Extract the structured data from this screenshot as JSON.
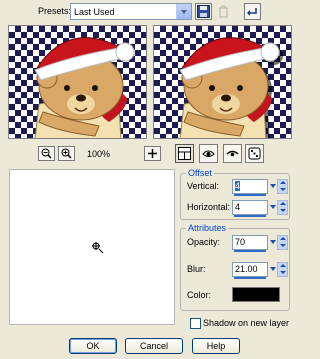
{
  "presets": {
    "label": "Presets:",
    "selected": "Last Used",
    "save_icon": "floppy-disk-icon",
    "delete_icon": "trash-icon",
    "reset_icon": "undo-arrow-icon"
  },
  "preview": {
    "left_alt": "teddy-bear-original",
    "right_alt": "teddy-bear-shadow"
  },
  "zoom": {
    "level": "100%"
  },
  "offset": {
    "title": "Offset",
    "vertical_label": "Vertical:",
    "vertical_value": "4",
    "horizontal_label": "Horizontal:",
    "horizontal_value": "4"
  },
  "attributes": {
    "title": "Attributes",
    "opacity_label": "Opacity:",
    "opacity_value": "70",
    "blur_label": "Blur:",
    "blur_value": "21.00",
    "color_label": "Color:",
    "color_value": "#000000"
  },
  "options": {
    "shadow_new_layer": "Shadow on new layer",
    "shadow_new_layer_checked": false
  },
  "buttons": {
    "ok": "OK",
    "cancel": "Cancel",
    "help": "Help"
  }
}
